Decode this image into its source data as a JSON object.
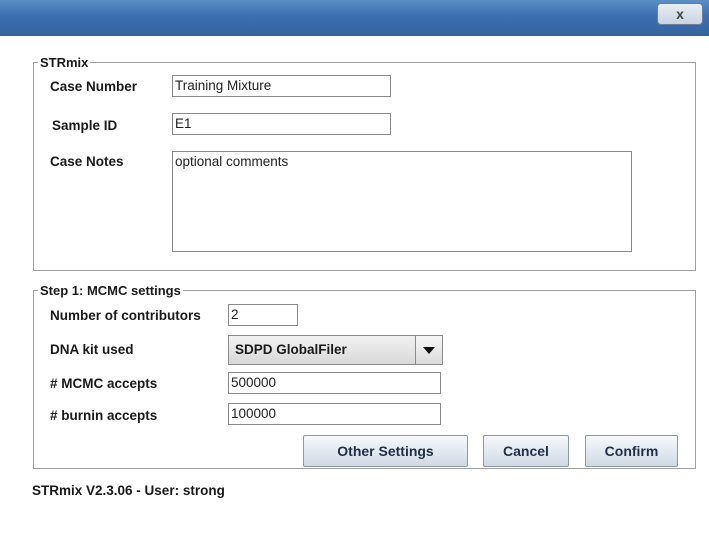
{
  "window": {
    "close_glyph": "x"
  },
  "strmix_group": {
    "legend": "STRmix",
    "case_number": {
      "label": "Case Number",
      "value": "Training Mixture"
    },
    "sample_id": {
      "label": "Sample ID",
      "value": "E1"
    },
    "case_notes": {
      "label": "Case Notes",
      "value": "optional comments"
    }
  },
  "mcmc_group": {
    "legend": "Step 1: MCMC settings",
    "contributors": {
      "label": "Number of contributors",
      "value": "2"
    },
    "dna_kit": {
      "label": "DNA kit used",
      "value": "SDPD GlobalFiler"
    },
    "mcmc_accepts": {
      "label": "# MCMC accepts",
      "value": "500000"
    },
    "burnin_accepts": {
      "label": "# burnin accepts",
      "value": "100000"
    }
  },
  "buttons": {
    "other_settings": "Other Settings",
    "cancel": "Cancel",
    "confirm": "Confirm"
  },
  "status_text": "STRmix V2.3.06 - User: strong",
  "colors": {
    "titlebar": "#3c6fb0",
    "button_face": "#e1e8f0",
    "border": "#a0a0a0"
  }
}
